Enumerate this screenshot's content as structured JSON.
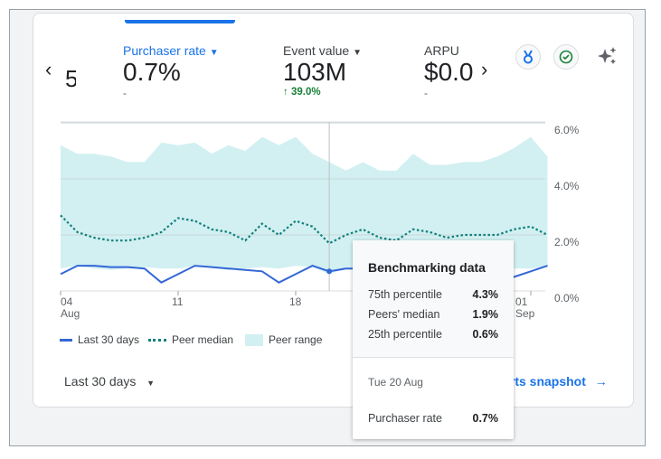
{
  "metrics": {
    "prev_partial": {
      "value": "5"
    },
    "items": [
      {
        "label": "Purchaser rate",
        "value": "0.7%",
        "change": "-",
        "active": true
      },
      {
        "label": "Event value",
        "value": "103M",
        "change": "39.0%",
        "change_direction": "up"
      },
      {
        "label": "ARPU",
        "value": "$0.0",
        "change": "-"
      }
    ],
    "prev_icon": "chevron-left-icon",
    "next_icon": "chevron-right-icon"
  },
  "header_icons": [
    "medal-icon",
    "check-circle-icon",
    "sparkle-icon"
  ],
  "colors": {
    "accent": "#1a73e8",
    "line": "#3367d6",
    "median": "#12807d",
    "range": "#d2f0f2",
    "positive": "#188038"
  },
  "chart_data": {
    "type": "line",
    "x": [
      "04 Aug",
      "05 Aug",
      "06 Aug",
      "07 Aug",
      "08 Aug",
      "09 Aug",
      "10 Aug",
      "11 Aug",
      "12 Aug",
      "13 Aug",
      "14 Aug",
      "15 Aug",
      "16 Aug",
      "17 Aug",
      "18 Aug",
      "19 Aug",
      "20 Aug",
      "21 Aug",
      "22 Aug",
      "23 Aug",
      "24 Aug",
      "25 Aug",
      "26 Aug",
      "27 Aug",
      "28 Aug",
      "29 Aug",
      "30 Aug",
      "31 Aug",
      "01 Sep",
      "02 Sep"
    ],
    "x_tick_labels": [
      {
        "day": "04",
        "month": "Aug",
        "index": 0
      },
      {
        "day": "11",
        "month": "",
        "index": 7
      },
      {
        "day": "18",
        "month": "",
        "index": 14
      },
      {
        "day": "01",
        "month": "Sep",
        "index": 28
      }
    ],
    "y_ticks": [
      "0.0%",
      "2.0%",
      "4.0%",
      "6.0%"
    ],
    "ylim": [
      0,
      6
    ],
    "grid": true,
    "series": [
      {
        "name": "Last 30 days",
        "style": "solid",
        "values": [
          0.6,
          0.9,
          0.9,
          0.85,
          0.85,
          0.8,
          0.3,
          0.6,
          0.9,
          0.85,
          0.8,
          0.75,
          0.7,
          0.3,
          0.6,
          0.9,
          0.7,
          0.8,
          0.8,
          0.75,
          0.7,
          0.7,
          0.65,
          0.6,
          0.6,
          0.5,
          0.3,
          0.5,
          0.7,
          0.9
        ]
      },
      {
        "name": "Peer median",
        "style": "dotted",
        "values": [
          2.7,
          2.1,
          1.9,
          1.8,
          1.8,
          1.9,
          2.1,
          2.6,
          2.5,
          2.2,
          2.1,
          1.8,
          2.4,
          2.0,
          2.5,
          2.3,
          1.7,
          2.0,
          2.2,
          1.9,
          1.8,
          2.2,
          2.1,
          1.9,
          2.0,
          2.0,
          2.0,
          2.2,
          2.3,
          2.0
        ]
      },
      {
        "name": "Peer range",
        "style": "area",
        "upper": [
          5.2,
          4.9,
          4.9,
          4.8,
          4.6,
          4.6,
          5.3,
          5.2,
          5.3,
          4.9,
          5.2,
          5.0,
          5.5,
          5.2,
          5.5,
          4.9,
          4.6,
          4.3,
          4.6,
          4.3,
          4.3,
          4.9,
          4.5,
          4.5,
          4.6,
          4.6,
          4.8,
          5.1,
          5.5,
          4.8
        ],
        "lower": [
          0.8,
          0.9,
          0.8,
          0.75,
          0.8,
          0.85,
          0.8,
          0.8,
          0.9,
          0.85,
          0.75,
          0.8,
          0.85,
          0.8,
          0.9,
          0.85,
          0.6,
          0.8,
          0.85,
          0.8,
          0.75,
          0.8,
          0.8,
          0.8,
          0.75,
          0.8,
          0.8,
          0.8,
          0.8,
          0.85
        ]
      }
    ],
    "hover_index": 16,
    "legend_placement": "bottom-left"
  },
  "legend": {
    "last30": "Last 30 days",
    "median": "Peer median",
    "range": "Peer range"
  },
  "footer": {
    "date_range": "Last 30 days",
    "link": "View reports snapshot"
  },
  "tooltip": {
    "title": "Benchmarking data",
    "rows": [
      {
        "label": "75th percentile",
        "value": "4.3%"
      },
      {
        "label": "Peers' median",
        "value": "1.9%"
      },
      {
        "label": "25th percentile",
        "value": "0.6%"
      }
    ],
    "date": "Tue 20 Aug",
    "metric_label": "Purchaser rate",
    "metric_value": "0.7%"
  }
}
